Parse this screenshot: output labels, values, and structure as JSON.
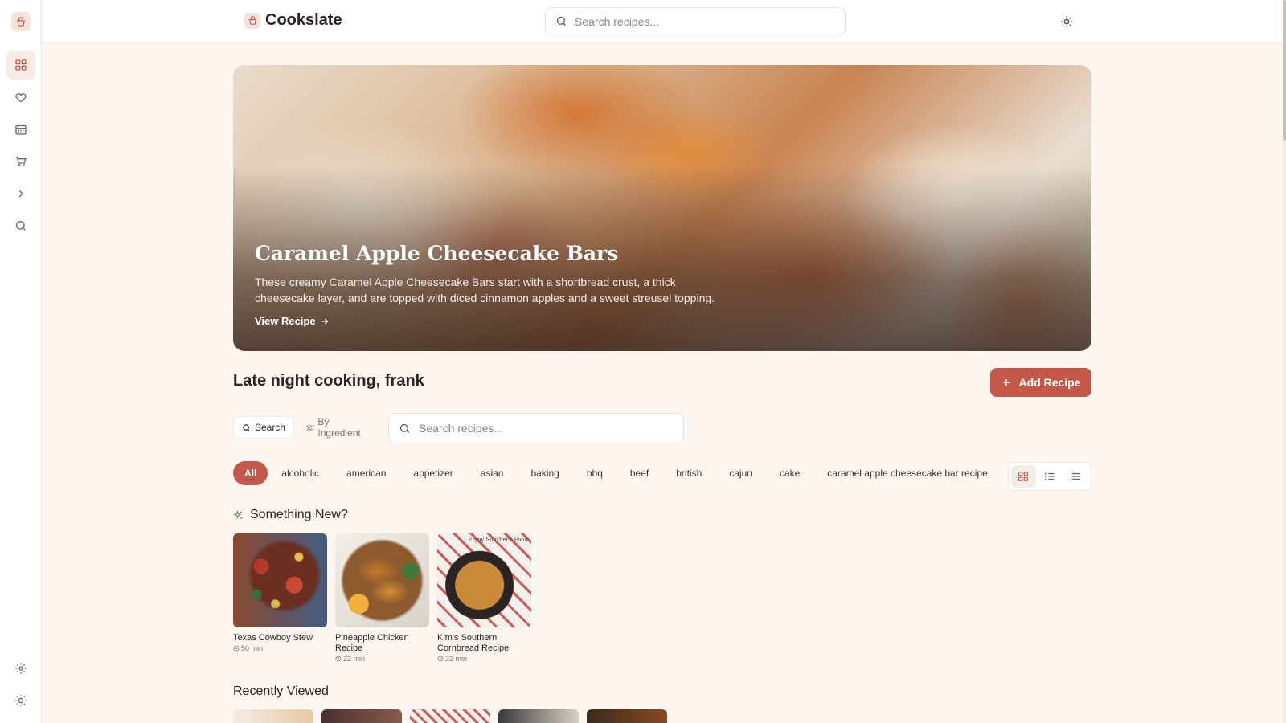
{
  "app": {
    "name": "Cookslate"
  },
  "sidebar": {
    "items": [
      {
        "icon": "grid-icon",
        "active": true
      },
      {
        "icon": "heart-icon"
      },
      {
        "icon": "calendar-icon"
      },
      {
        "icon": "cart-icon"
      },
      {
        "icon": "chevron-right-icon"
      },
      {
        "icon": "search-icon"
      }
    ],
    "bottom": [
      {
        "icon": "gear-icon"
      },
      {
        "icon": "sun-icon"
      }
    ]
  },
  "header": {
    "search_placeholder": "Search recipes..."
  },
  "hero": {
    "title": "Caramel Apple Cheesecake Bars",
    "description": "These creamy Caramel Apple Cheesecake Bars start with a shortbread crust, a thick cheesecake layer, and are topped with diced cinnamon apples and a sweet streusel topping.",
    "link_label": "View Recipe"
  },
  "greeting": "Late night cooking, frank",
  "add_recipe_label": "Add Recipe",
  "search_modes": {
    "search": "Search",
    "by_ingredient": "By Ingredient"
  },
  "main_search_placeholder": "Search recipes...",
  "tags": [
    "All",
    "alcoholic",
    "american",
    "appetizer",
    "asian",
    "baking",
    "bbq",
    "beef",
    "british",
    "cajun",
    "cake",
    "caramel apple cheesecake bar recipe"
  ],
  "sections": {
    "something_new": {
      "title": "Something New?",
      "cards": [
        {
          "title": "Texas Cowboy Stew",
          "time": "50 min"
        },
        {
          "title": "Pineapple Chicken Recipe",
          "time": "22 min"
        },
        {
          "title": "Kim's Southern Cornbread Recipe",
          "time": "32 min",
          "stamp": "Enjoy Southern Food"
        }
      ]
    },
    "recently_viewed": {
      "title": "Recently Viewed"
    }
  },
  "colors": {
    "accent": "#c4594a",
    "background": "#fdf6f1"
  }
}
